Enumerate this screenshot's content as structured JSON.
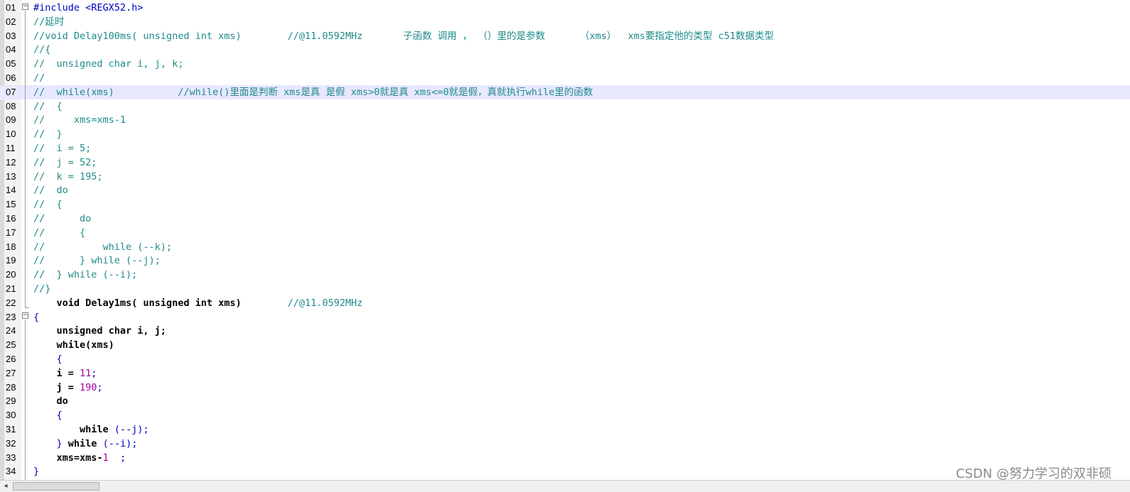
{
  "editor": {
    "lines": [
      {
        "n": "01",
        "segs": [
          {
            "t": "#include <REGX52.h>",
            "c": "pre"
          }
        ]
      },
      {
        "n": "02",
        "segs": [
          {
            "t": "//延时",
            "c": "cm"
          }
        ]
      },
      {
        "n": "03",
        "segs": [
          {
            "t": "//void Delay100ms( unsigned int xms)        //@11.0592MHz       子函数 调用 ， （）里的是参数      （xms）  xms要指定他的类型 c51数据类型",
            "c": "cm"
          }
        ]
      },
      {
        "n": "04",
        "segs": [
          {
            "t": "//{",
            "c": "cm"
          }
        ]
      },
      {
        "n": "05",
        "segs": [
          {
            "t": "//  unsigned char i, j, k;",
            "c": "cm"
          }
        ]
      },
      {
        "n": "06",
        "segs": [
          {
            "t": "//",
            "c": "cm"
          }
        ]
      },
      {
        "n": "07",
        "segs": [
          {
            "t": "//  while(xms)           //while()里面是判断 xms是真 是假 xms>0就是真 xms<=0就是假，真就执行while里的函数",
            "c": "cm"
          }
        ]
      },
      {
        "n": "08",
        "segs": [
          {
            "t": "//  {",
            "c": "cm"
          }
        ]
      },
      {
        "n": "09",
        "segs": [
          {
            "t": "//     xms=xms-1",
            "c": "cm"
          }
        ]
      },
      {
        "n": "10",
        "segs": [
          {
            "t": "//  }",
            "c": "cm"
          }
        ]
      },
      {
        "n": "11",
        "segs": [
          {
            "t": "//  i = 5;",
            "c": "cm"
          }
        ]
      },
      {
        "n": "12",
        "segs": [
          {
            "t": "//  j = 52;",
            "c": "cm"
          }
        ]
      },
      {
        "n": "13",
        "segs": [
          {
            "t": "//  k = 195;",
            "c": "cm"
          }
        ]
      },
      {
        "n": "14",
        "segs": [
          {
            "t": "//  do",
            "c": "cm"
          }
        ]
      },
      {
        "n": "15",
        "segs": [
          {
            "t": "//  {",
            "c": "cm"
          }
        ]
      },
      {
        "n": "16",
        "segs": [
          {
            "t": "//      do",
            "c": "cm"
          }
        ]
      },
      {
        "n": "17",
        "segs": [
          {
            "t": "//      {",
            "c": "cm"
          }
        ]
      },
      {
        "n": "18",
        "segs": [
          {
            "t": "//          while (--k);",
            "c": "cm"
          }
        ]
      },
      {
        "n": "19",
        "segs": [
          {
            "t": "//      } while (--j);",
            "c": "cm"
          }
        ]
      },
      {
        "n": "20",
        "segs": [
          {
            "t": "//  } while (--i);",
            "c": "cm"
          }
        ]
      },
      {
        "n": "21",
        "segs": [
          {
            "t": "//}",
            "c": "cm"
          }
        ]
      },
      {
        "n": "22",
        "segs": [
          {
            "t": "    void Delay1ms( unsigned int xms)",
            "c": "kw"
          },
          {
            "t": "        //@11.0592MHz",
            "c": "cm"
          }
        ]
      },
      {
        "n": "23",
        "segs": [
          {
            "t": "{",
            "c": "br"
          }
        ]
      },
      {
        "n": "24",
        "segs": [
          {
            "t": "    unsigned char i, j;",
            "c": "kw"
          }
        ]
      },
      {
        "n": "25",
        "segs": [
          {
            "t": "    while(xms)",
            "c": "kw"
          }
        ]
      },
      {
        "n": "26",
        "segs": [
          {
            "t": "    {",
            "c": "br"
          }
        ]
      },
      {
        "n": "27",
        "segs": [
          {
            "t": "    i = ",
            "c": "kw"
          },
          {
            "t": "11",
            "c": "num"
          },
          {
            "t": ";",
            "c": "br"
          }
        ]
      },
      {
        "n": "28",
        "segs": [
          {
            "t": "    j = ",
            "c": "kw"
          },
          {
            "t": "190",
            "c": "num"
          },
          {
            "t": ";",
            "c": "br"
          }
        ]
      },
      {
        "n": "29",
        "segs": [
          {
            "t": "    do",
            "c": "kw"
          }
        ]
      },
      {
        "n": "30",
        "segs": [
          {
            "t": "    {",
            "c": "br"
          }
        ]
      },
      {
        "n": "31",
        "segs": [
          {
            "t": "        while ",
            "c": "kw"
          },
          {
            "t": "(--j);",
            "c": "br"
          }
        ]
      },
      {
        "n": "32",
        "segs": [
          {
            "t": "    } ",
            "c": "br"
          },
          {
            "t": "while ",
            "c": "kw"
          },
          {
            "t": "(--i);",
            "c": "br"
          }
        ]
      },
      {
        "n": "33",
        "segs": [
          {
            "t": "    xms=xms-",
            "c": "kw"
          },
          {
            "t": "1",
            "c": "num"
          },
          {
            "t": "  ;",
            "c": "br"
          }
        ]
      },
      {
        "n": "34",
        "segs": [
          {
            "t": "}",
            "c": "br"
          }
        ]
      }
    ],
    "current_line_index": 6
  },
  "scrollbar": {
    "left_arrow_glyph": "◂"
  },
  "watermark": "CSDN @努力学习的双非硕"
}
